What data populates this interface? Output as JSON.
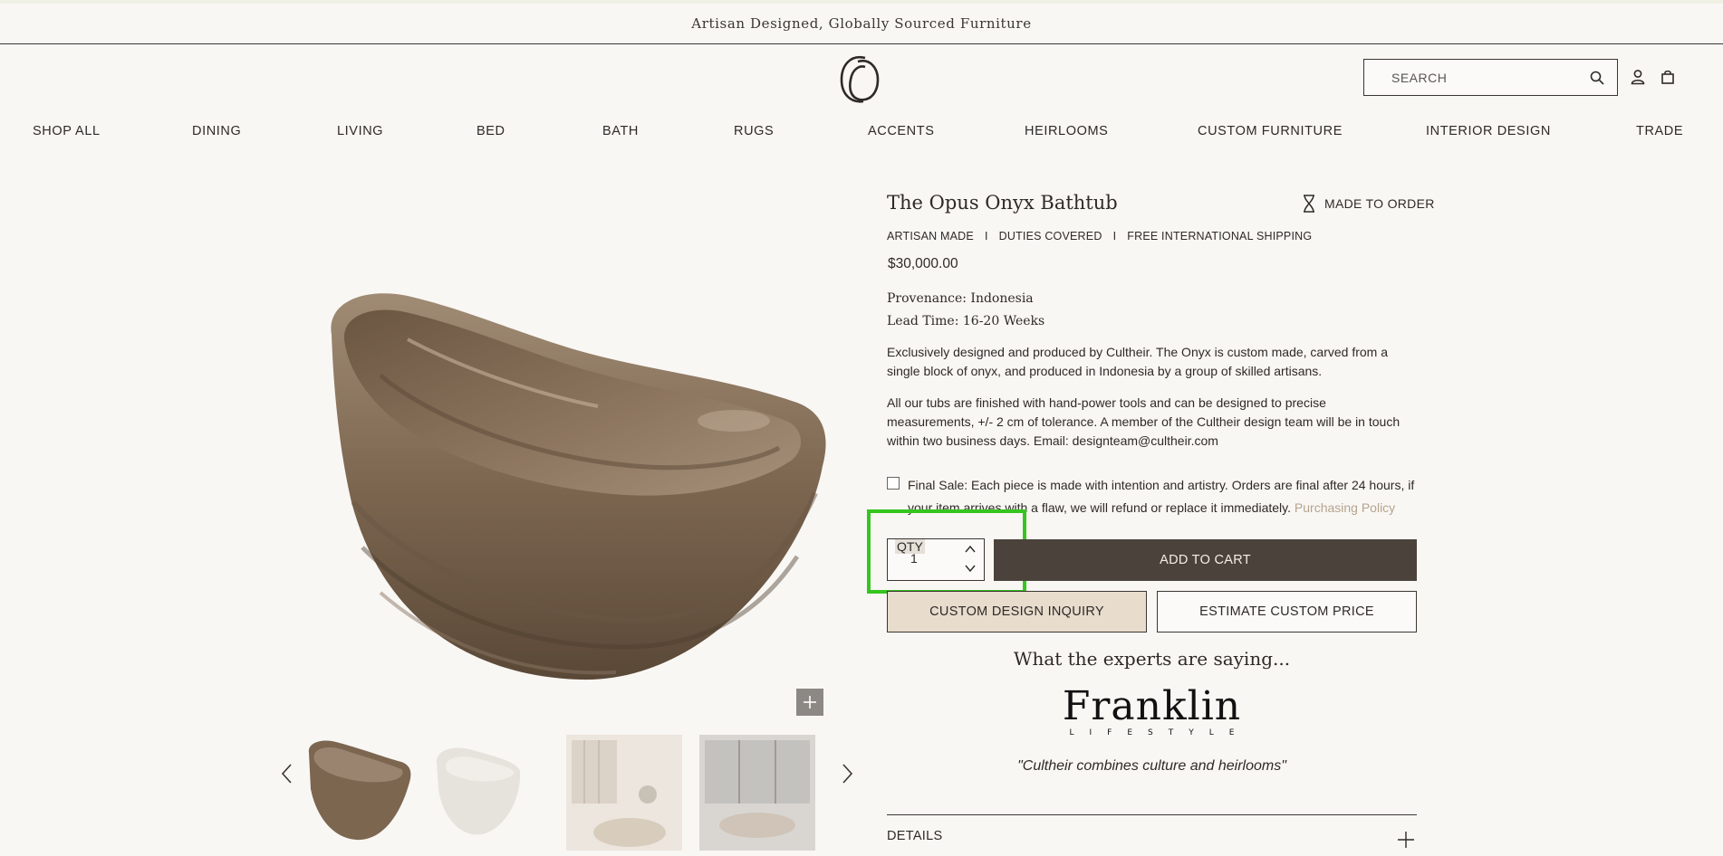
{
  "announcement": "Artisan Designed, Globally Sourced Furniture",
  "header": {
    "search_placeholder": "SEARCH",
    "icons": [
      "logo-icon",
      "search-icon",
      "account-icon",
      "cart-icon"
    ]
  },
  "nav": {
    "items": [
      "SHOP ALL",
      "DINING",
      "LIVING",
      "BED",
      "BATH",
      "RUGS",
      "ACCENTS",
      "HEIRLOOMS",
      "CUSTOM FURNITURE",
      "INTERIOR DESIGN",
      "TRADE"
    ]
  },
  "product": {
    "title": "The Opus Onyx Bathtub",
    "made_to_order": "MADE TO ORDER",
    "tags": [
      "ARTISAN MADE",
      "DUTIES COVERED",
      "FREE INTERNATIONAL SHIPPING"
    ],
    "tag_separator": "I",
    "price": "$30,000.00",
    "provenance": "Provenance: Indonesia",
    "lead_time": "Lead Time: 16-20 Weeks",
    "description_1": "Exclusively designed and produced by Cultheir. The Onyx is custom made, carved from a single block of onyx, and produced in Indonesia by a group of skilled artisans.",
    "description_2": "All our tubs are finished with hand-power tools and can be designed to precise measurements, +/- 2 cm of tolerance.   A member of the Cultheir design team will be in touch within two business days. Email: designteam@cultheir.com",
    "final_sale": "Final Sale: Each piece is made with intention and artistry. Orders are final after 24 hours, if your item arrives with a flaw, we will refund or replace it immediately.",
    "policy_link": "Purchasing Policy",
    "final_sale_checked": false
  },
  "purchase": {
    "qty_label": "QTY",
    "qty_value": "1",
    "add_to_cart": "ADD TO CART",
    "custom_inquiry": "CUSTOM DESIGN INQUIRY",
    "estimate_price": "ESTIMATE CUSTOM PRICE"
  },
  "press": {
    "heading": "What the experts are saying...",
    "brand": "Franklin",
    "brand_sub": "LIFESTYLE",
    "quote": "\"Cultheir combines culture and heirlooms\""
  },
  "accordion": {
    "details": "DETAILS"
  },
  "colors": {
    "background": "#f9f7f4",
    "primary_button": "#4b433b",
    "inquiry_button": "#e8dccd",
    "link": "#b5a38d",
    "highlight": "#35c51f"
  }
}
